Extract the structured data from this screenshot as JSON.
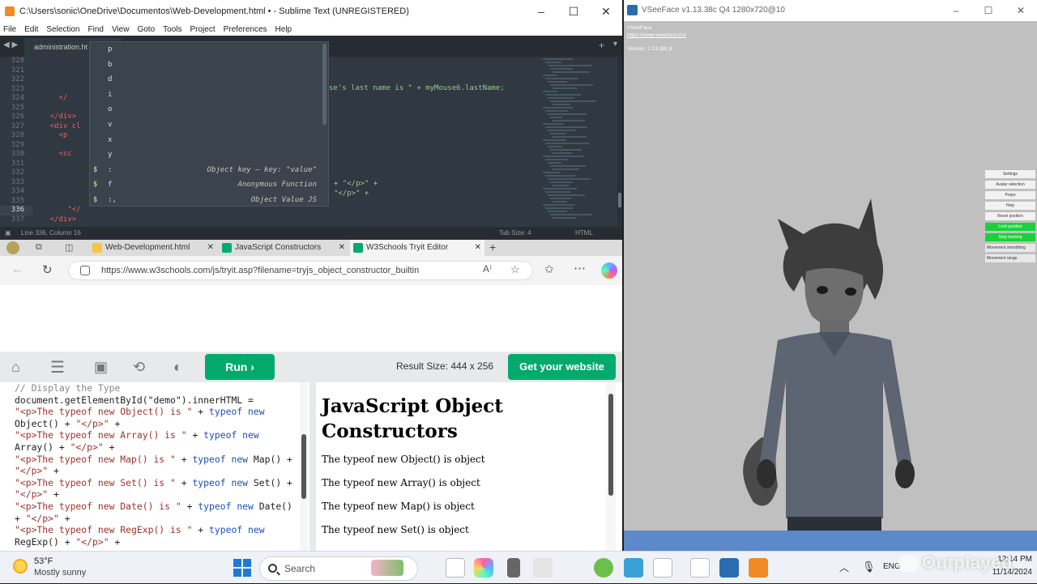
{
  "sublime": {
    "title": "C:\\Users\\sonic\\OneDrive\\Documentos\\Web-Development.html • - Sublime Text (UNREGISTERED)",
    "menu": [
      "File",
      "Edit",
      "Selection",
      "Find",
      "View",
      "Goto",
      "Tools",
      "Project",
      "Preferences",
      "Help"
    ],
    "tab": "administration.ht",
    "line_numbers": [
      "320",
      "321",
      "322",
      "323",
      "324",
      "325",
      "326",
      "327",
      "328",
      "329",
      "330",
      "331",
      "332",
      "333",
      "334",
      "335",
      "336",
      "337"
    ],
    "current_line": "336",
    "code_lines": [
      "",
      "",
      "",
      "                                                ",
      "      </",
      "",
      "    </div>",
      "    <div cl",
      "      <p",
      "",
      "      <sc",
      "",
      "",
      "",
      "",
      "",
      "        \"</",
      "    </div>"
    ],
    "code_tail_323": "se's last name is \" + myMouse6.lastName;",
    "code_tail_333": "+ \"</p>\" +",
    "code_tail_334": "\"</p>\" +",
    "autocomplete": [
      {
        "kind": "",
        "text": "p",
        "hint": ""
      },
      {
        "kind": "",
        "text": "b",
        "hint": ""
      },
      {
        "kind": "",
        "text": "d",
        "hint": ""
      },
      {
        "kind": "",
        "text": "i",
        "hint": ""
      },
      {
        "kind": "",
        "text": "o",
        "hint": ""
      },
      {
        "kind": "",
        "text": "v",
        "hint": ""
      },
      {
        "kind": "",
        "text": "x",
        "hint": ""
      },
      {
        "kind": "",
        "text": "y",
        "hint": ""
      },
      {
        "kind": "$",
        "text": ":",
        "hint": "Object key — key: \"value\""
      },
      {
        "kind": "$",
        "text": "f",
        "hint": "Anonymous Function"
      },
      {
        "kind": "$",
        "text": ":,",
        "hint": "Object Value JS"
      }
    ],
    "status_left": "Line 336, Column 16",
    "status_tab": "Tab Size: 4",
    "status_syntax": "HTML"
  },
  "browser": {
    "tabs": [
      {
        "label": "Web-Development.html",
        "color": "#f5c542"
      },
      {
        "label": "JavaScript Constructors",
        "color": "#04aa6d"
      },
      {
        "label": "W3Schools Tryit Editor",
        "color": "#04aa6d"
      }
    ],
    "url": "https://www.w3schools.com/js/tryit.asp?filename=tryjs_object_constructor_builtin",
    "run_label": "Run",
    "result_size": "Result Size: 444 x 256",
    "get_site_label": "Get your website",
    "editor_lines": [
      [
        {
          "c": "cm",
          "t": "// Display the Type"
        }
      ],
      [
        {
          "c": "",
          "t": "document.getElementById(\"demo\").innerHTML ="
        }
      ],
      [
        {
          "c": "s",
          "t": "\"<p>The typeof new Object() is \""
        },
        {
          "c": "",
          "t": " + "
        },
        {
          "c": "kw",
          "t": "typeof new"
        }
      ],
      [
        {
          "c": "",
          "t": "Object() + "
        },
        {
          "c": "s",
          "t": "\"</p>\""
        },
        {
          "c": "",
          "t": " +"
        }
      ],
      [
        {
          "c": "s",
          "t": "\"<p>The typeof new Array() is \""
        },
        {
          "c": "",
          "t": " + "
        },
        {
          "c": "kw",
          "t": "typeof new"
        }
      ],
      [
        {
          "c": "",
          "t": "Array() + "
        },
        {
          "c": "s",
          "t": "\"</p>\""
        },
        {
          "c": "",
          "t": " +"
        }
      ],
      [
        {
          "c": "s",
          "t": "\"<p>The typeof new Map() is \""
        },
        {
          "c": "",
          "t": " + "
        },
        {
          "c": "kw",
          "t": "typeof new"
        },
        {
          "c": "",
          "t": " Map() +"
        }
      ],
      [
        {
          "c": "s",
          "t": "\"</p>\""
        },
        {
          "c": "",
          "t": " +"
        }
      ],
      [
        {
          "c": "s",
          "t": "\"<p>The typeof new Set() is \""
        },
        {
          "c": "",
          "t": " + "
        },
        {
          "c": "kw",
          "t": "typeof new"
        },
        {
          "c": "",
          "t": " Set() +"
        }
      ],
      [
        {
          "c": "s",
          "t": "\"</p>\""
        },
        {
          "c": "",
          "t": " +"
        }
      ],
      [
        {
          "c": "s",
          "t": "\"<p>The typeof new Date() is \""
        },
        {
          "c": "",
          "t": " + "
        },
        {
          "c": "kw",
          "t": "typeof new"
        },
        {
          "c": "",
          "t": " Date()"
        }
      ],
      [
        {
          "c": "",
          "t": "+ "
        },
        {
          "c": "s",
          "t": "\"</p>\""
        },
        {
          "c": "",
          "t": " +"
        }
      ],
      [
        {
          "c": "s",
          "t": "\"<p>The typeof new RegExp() is \""
        },
        {
          "c": "",
          "t": " + "
        },
        {
          "c": "kw",
          "t": "typeof new"
        }
      ],
      [
        {
          "c": "",
          "t": "RegExp() + "
        },
        {
          "c": "s",
          "t": "\"</p>\""
        },
        {
          "c": "",
          "t": " +"
        }
      ]
    ],
    "result_heading": "JavaScript Object Constructors",
    "result_lines": [
      "The typeof new Object() is object",
      "The typeof new Array() is object",
      "The typeof new Map() is object",
      "The typeof new Set() is object"
    ]
  },
  "vseeface": {
    "title": "VSeeFace v1.13.38c Q4 1280x720@10",
    "name": "VSeeFace",
    "link": "https://www.vseeface.icu/",
    "version": "Version: 1.13.38c β",
    "panel": [
      {
        "label": "Settings",
        "style": ""
      },
      {
        "label": "Avatar selection",
        "style": ""
      },
      {
        "label": "Props",
        "style": ""
      },
      {
        "label": "Help",
        "style": ""
      },
      {
        "label": "Reset position",
        "style": ""
      },
      {
        "label": "Lock position",
        "style": "green"
      },
      {
        "label": "Stop tracking",
        "style": "green"
      },
      {
        "label": "Movement smoothing",
        "style": "slider"
      },
      {
        "label": "Movement range",
        "style": "slider"
      }
    ]
  },
  "taskbar": {
    "temperature": "53°F",
    "condition": "Mostly sunny",
    "search_placeholder": "Search",
    "lang": "ENG",
    "time": "12:14 PM",
    "date": "11/14/2024"
  },
  "watermark": "Outplayed",
  "colors": {
    "accent_green": "#04aa6d",
    "sublime_bg": "#303841",
    "vsee_floor": "#5b89c9"
  }
}
